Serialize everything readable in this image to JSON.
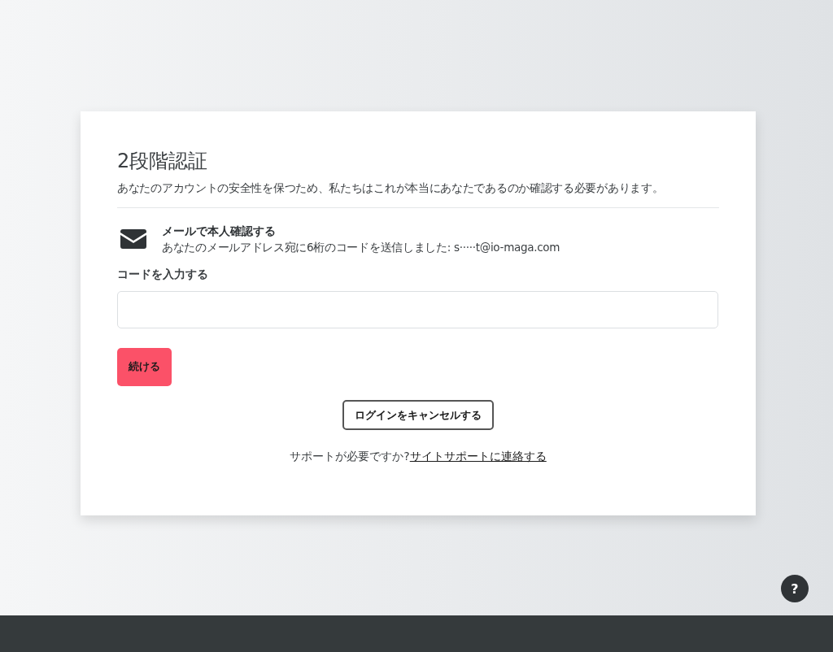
{
  "card": {
    "title": "2段階認証",
    "description": "あなたのアカウントの安全性を保つため、私たちはこれが本当にあなたであるのか確認する必要があります。",
    "method": {
      "title": "メールで本人確認する",
      "detail": "あなたのメールアドレス宛に6桁のコードを送信しました: s·····t@io-maga.com"
    },
    "code_field": {
      "label": "コードを入力する"
    },
    "continue_button": "続ける",
    "cancel_button": "ログインをキャンセルする",
    "support": {
      "text": "サポートが必要ですか?",
      "link": "サイトサポートに連絡する"
    }
  },
  "help_button": "?"
}
